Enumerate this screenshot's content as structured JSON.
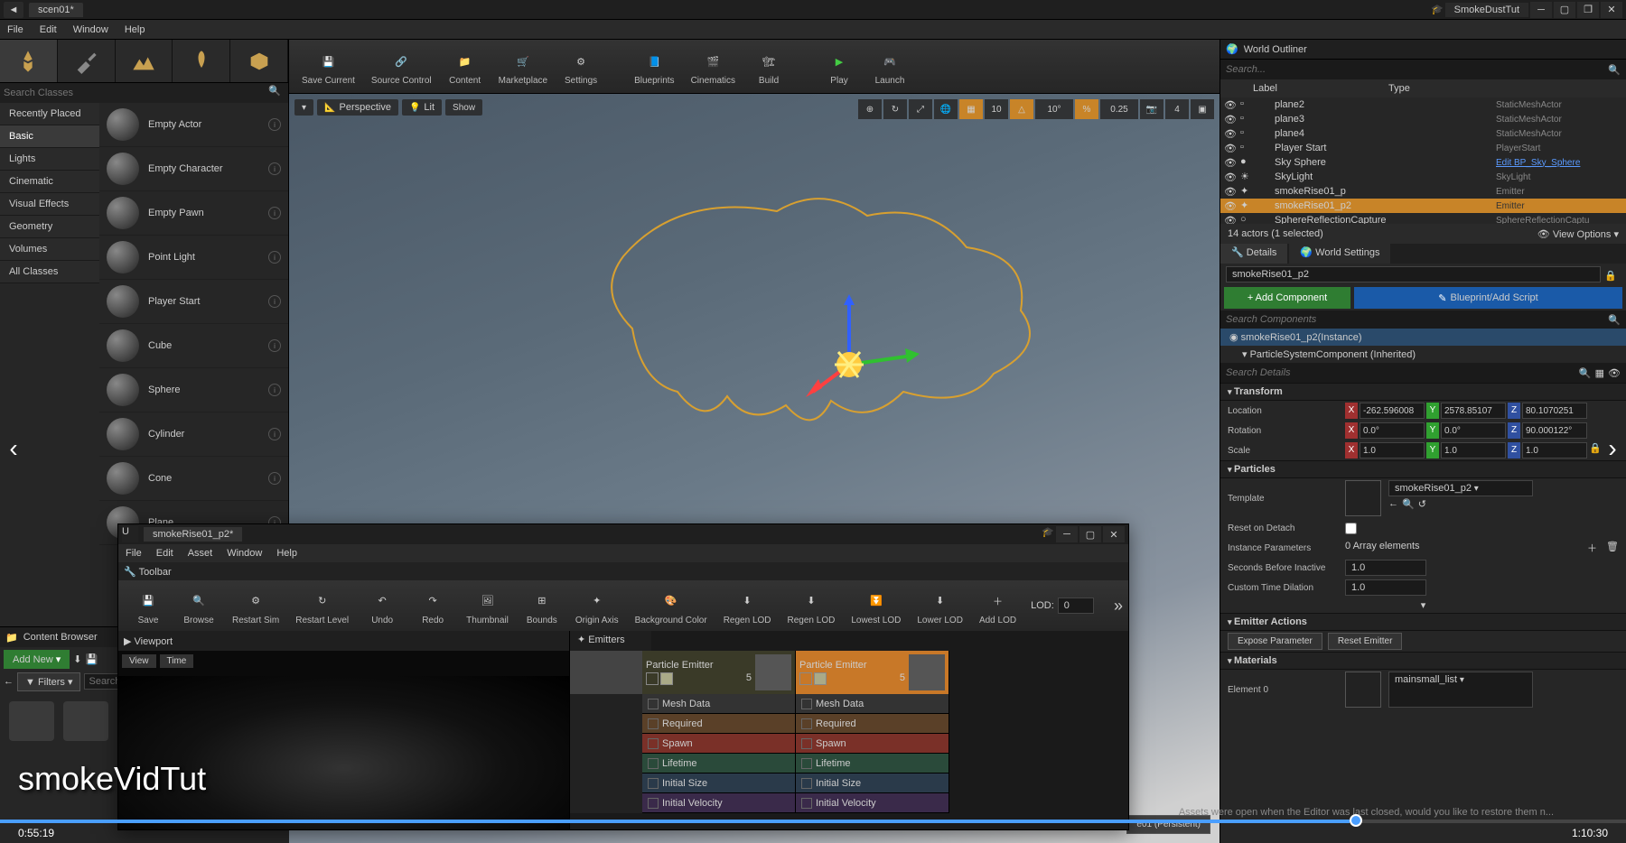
{
  "titlebar": {
    "scene": "scen01*",
    "project": "SmokeDustTut"
  },
  "menu": [
    "File",
    "Edit",
    "Window",
    "Help"
  ],
  "modes": {
    "search_ph": "Search Classes"
  },
  "categories": [
    "Recently Placed",
    "Basic",
    "Lights",
    "Cinematic",
    "Visual Effects",
    "Geometry",
    "Volumes",
    "All Classes"
  ],
  "active_category": "Basic",
  "place_items": [
    "Empty Actor",
    "Empty Character",
    "Empty Pawn",
    "Point Light",
    "Player Start",
    "Cube",
    "Sphere",
    "Cylinder",
    "Cone",
    "Plane"
  ],
  "toolbar": [
    {
      "label": "Save Current"
    },
    {
      "label": "Source Control",
      "drop": true
    },
    {
      "label": "Content"
    },
    {
      "label": "Marketplace"
    },
    {
      "label": "Settings",
      "drop": true
    },
    {
      "label": "Blueprints",
      "drop": true
    },
    {
      "label": "Cinematics",
      "drop": true
    },
    {
      "label": "Build",
      "drop": true
    },
    {
      "label": "Play",
      "drop": true
    },
    {
      "label": "Launch",
      "drop": true
    }
  ],
  "viewport": {
    "perspective": "Perspective",
    "lit": "Lit",
    "show": "Show",
    "snap_angle": "10",
    "snap_angle2": "10°",
    "snap_scale": "0.25",
    "cam_speed": "4",
    "persistent": "e01 (Persistent)"
  },
  "outliner": {
    "title": "World Outliner",
    "search_ph": "Search...",
    "label_col": "Label",
    "type_col": "Type",
    "rows": [
      {
        "name": "plane2",
        "type": "StaticMeshActor"
      },
      {
        "name": "plane3",
        "type": "StaticMeshActor"
      },
      {
        "name": "plane4",
        "type": "StaticMeshActor"
      },
      {
        "name": "Player Start",
        "type": "PlayerStart"
      },
      {
        "name": "Sky Sphere",
        "type": "Edit BP_Sky_Sphere",
        "link": true
      },
      {
        "name": "SkyLight",
        "type": "SkyLight"
      },
      {
        "name": "smokeRise01_p",
        "type": "Emitter"
      },
      {
        "name": "smokeRise01_p2",
        "type": "Emitter",
        "sel": true
      },
      {
        "name": "SphereReflectionCapture",
        "type": "SphereReflectionCaptu"
      }
    ],
    "footer": "14 actors (1 selected)",
    "view_opts": "View Options"
  },
  "details": {
    "tab1": "Details",
    "tab2": "World Settings",
    "name": "smokeRise01_p2",
    "add_comp": "+ Add Component",
    "bp_script": "Blueprint/Add Script",
    "comp_search_ph": "Search Components",
    "comp1": "smokeRise01_p2(Instance)",
    "comp2": "ParticleSystemComponent (Inherited)",
    "detail_search_ph": "Search Details",
    "transform": "Transform",
    "loc_label": "Location",
    "loc": {
      "x": "-262.596008",
      "y": "2578.85107",
      "z": "80.1070251"
    },
    "rot_label": "Rotation",
    "rot": {
      "x": "0.0°",
      "y": "0.0°",
      "z": "90.000122°"
    },
    "scale_label": "Scale",
    "scale": {
      "x": "1.0",
      "y": "1.0",
      "z": "1.0"
    },
    "particles": "Particles",
    "template_label": "Template",
    "template_name": "smokeRise01_p2",
    "reset_detach": "Reset on Detach",
    "inst_params": "Instance Parameters",
    "inst_val": "0 Array elements",
    "sec_before": "Seconds Before Inactive",
    "sec_val": "1.0",
    "time_dil": "Custom Time Dilation",
    "time_val": "1.0",
    "emit_actions": "Emitter Actions",
    "expose": "Expose Parameter",
    "reset_emit": "Reset Emitter",
    "materials": "Materials",
    "elem0": "Element 0",
    "mat_name": "mainsmall_list"
  },
  "cascade": {
    "tab": "smokeRise01_p2*",
    "menu": [
      "File",
      "Edit",
      "Asset",
      "Window",
      "Help"
    ],
    "toolbar_tab": "Toolbar",
    "tools": [
      "Save",
      "Browse",
      "Restart Sim",
      "Restart Level",
      "Undo",
      "Redo",
      "Thumbnail",
      "Bounds",
      "Origin Axis",
      "Background Color",
      "Regen LOD",
      "Regen LOD",
      "Lowest LOD",
      "Lower LOD",
      "Add LOD"
    ],
    "lod": "LOD:",
    "lod_val": "0",
    "viewport_tab": "Viewport",
    "view_btn": "View",
    "time_btn": "Time",
    "emitters_tab": "Emitters",
    "emit1": "Particle Emitter",
    "emit1_n": "5",
    "emit2": "Particle Emitter",
    "emit2_n": "5",
    "mods": [
      "Mesh Data",
      "Required",
      "Spawn",
      "Lifetime",
      "Initial Size",
      "Initial Velocity"
    ]
  },
  "content_browser": {
    "title": "Content Browser",
    "add_new": "Add New",
    "import_icon": "⬇",
    "save_icon": "💾",
    "filters": "Filters",
    "search_ph": "Search"
  },
  "video": {
    "title": "smokeVidTut",
    "cur": "0:55:19",
    "total": "1:10:30"
  },
  "restore_msg": "Assets were open when the Editor was last closed, would you like to restore them n..."
}
